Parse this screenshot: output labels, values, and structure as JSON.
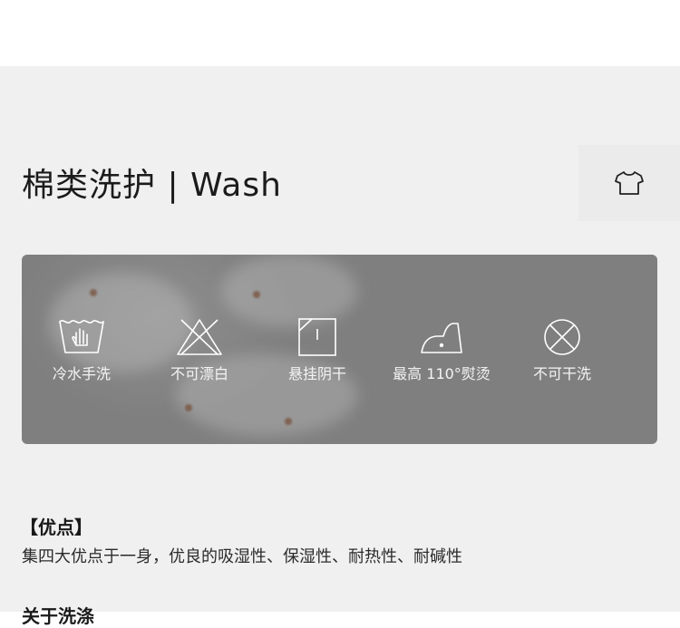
{
  "header": {
    "title": "棉类洗护 | Wash",
    "badge_icon": "tshirt-icon"
  },
  "care": {
    "items": [
      {
        "icon": "cold-wash-icon",
        "label": "冷水手洗"
      },
      {
        "icon": "no-bleach-icon",
        "label": "不可漂白"
      },
      {
        "icon": "hang-dry-shade-icon",
        "label": "悬挂阴干"
      },
      {
        "icon": "iron-110-icon",
        "label": "最高 110°熨烫"
      },
      {
        "icon": "no-dry-clean-icon",
        "label": "不可干洗"
      }
    ]
  },
  "advantages": {
    "heading": "【优点】",
    "text": "集四大优点于一身，优良的吸湿性、保湿性、耐热性、耐碱性"
  },
  "next_section": {
    "heading_partial": "关于洗涤"
  },
  "colors": {
    "panel_bg": "#f0f0f0",
    "card_bg": "#7c7c7c",
    "title_text": "#1b1b1b",
    "icon_stroke": "#ffffff"
  }
}
